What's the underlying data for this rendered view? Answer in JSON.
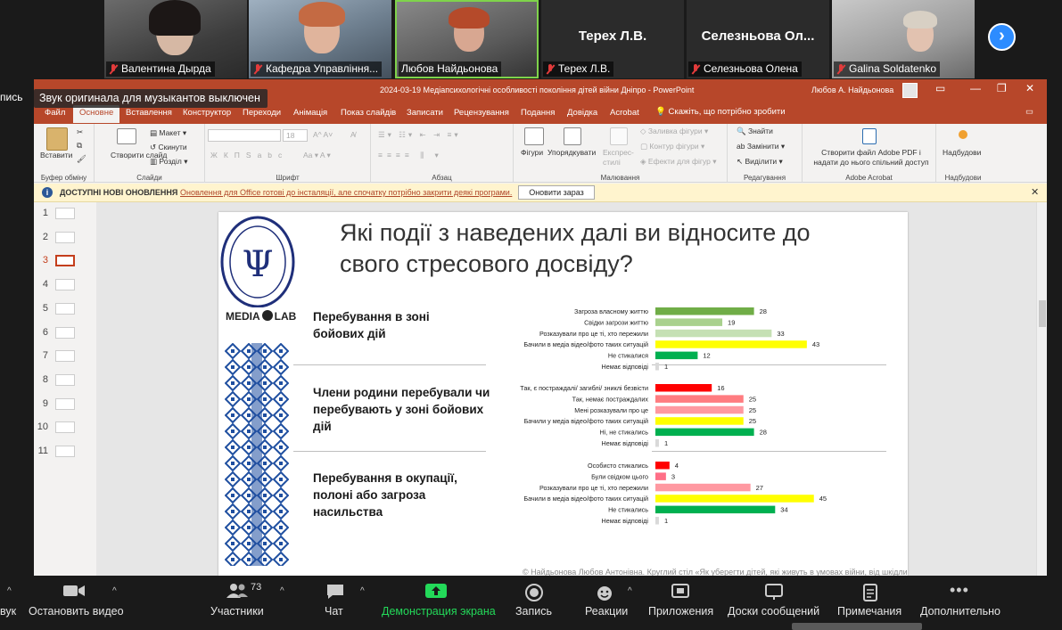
{
  "participants": [
    {
      "name": "Валентина Дырда",
      "type": "video"
    },
    {
      "name": "Кафедра Управління...",
      "type": "video"
    },
    {
      "name": "Любов Найдьонова",
      "type": "video"
    },
    {
      "name": "Терех Л.В.",
      "big_name": "Терех Л.В.",
      "type": "name"
    },
    {
      "name": "Селезньова Олена",
      "big_name": "Селезньова Ол...",
      "type": "name"
    },
    {
      "name": "Galina Soldatenko",
      "type": "video"
    }
  ],
  "zoom_notice": "Звук оригинала для музыкантов выключен",
  "zoom_left_fragment": "пись",
  "ppt": {
    "doc_title": "2024-03-19 Медіапсихологічні особливості покоління дітей війни Дніпро  -  PowerPoint",
    "user": "Любов А. Найдьонова",
    "tabs": [
      "Файл",
      "Основне",
      "Вставлення",
      "Конструктор",
      "Переходи",
      "Анімація",
      "Показ слайдів",
      "Записати",
      "Рецензування",
      "Подання",
      "Довідка",
      "Acrobat"
    ],
    "active_tab": "Основне",
    "tell_me": "Скажіть, що потрібно зробити",
    "ribbon": {
      "paste": "Вставити",
      "new_slide": "Створити слайд",
      "layout": "Макет",
      "reset": "Скинути",
      "section": "Розділ",
      "font_size": "18",
      "shapes": "Фігури",
      "arrange": "Упорядкувати",
      "quick_styles": "Експрес-стилі",
      "shape_fill": "Заливка фігури",
      "shape_outline": "Контур фігури",
      "shape_effects": "Ефекти для фігур",
      "find": "Знайти",
      "replace": "Замінити",
      "select": "Виділити",
      "acrobat_btn": "Створити файл Adobe PDF і надати до нього спільний доступ",
      "addins": "Надбудови",
      "groups": [
        "Буфер обміну",
        "Слайди",
        "Шрифт",
        "Абзац",
        "Малювання",
        "Редагування",
        "Adobe Acrobat",
        "Надбудови"
      ]
    },
    "update_bar": {
      "title": "ДОСТУПНІ НОВІ ОНОВЛЕННЯ",
      "message": "Оновлення для Office готові до інсталяції, але спочатку потрібно закрити деякі програми.",
      "button": "Оновити зараз"
    },
    "thumbnails": [
      "1",
      "2",
      "3",
      "4",
      "5",
      "6",
      "7",
      "8",
      "9",
      "10",
      "11"
    ],
    "selected_slide": "3"
  },
  "slide": {
    "title": "Які події з наведених далі ви відносите до свого стресового досвіду?",
    "logo_text": "MEDIA",
    "logo_text2": "LAB",
    "sections": [
      {
        "label": "Перебування в зоні бойових дій"
      },
      {
        "label": "Члени родини перебували чи перебувають у зоні бойових дій"
      },
      {
        "label": "Перебування в окупації, полоні або загроза насильства"
      }
    ],
    "footer": "© Найдьонова Любов Антонівна. Круглий стіл «Як уберегти дітей, які живуть в умовах війни, від шкідливої"
  },
  "chart_data": {
    "type": "bar",
    "orientation": "horizontal",
    "panels": [
      {
        "categories": [
          "Загроза власному життю",
          "Свідки загрози життю",
          "Розказували про це ті, хто пережили",
          "Бачили в медіа відео/фото таких ситуацій",
          "Не стикалися",
          "Немає відповіді"
        ],
        "values": [
          28,
          19,
          33,
          43,
          12,
          1
        ],
        "colors": [
          "#70ad47",
          "#a9d18e",
          "#c5e0b4",
          "#ffff00",
          "#00b050",
          "#d9d9d9"
        ]
      },
      {
        "categories": [
          "Так, є постраждалі/ загиблі/ зниклі безвісти",
          "Так, немає постраждалих",
          "Мені розказували про це",
          "Бачили у медіа відео/фото таких ситуацій",
          "Ні, не стикались",
          "Немає відповіді"
        ],
        "values": [
          16,
          25,
          25,
          25,
          28,
          1
        ],
        "colors": [
          "#ff0000",
          "#ff7c80",
          "#ff99a1",
          "#ffff00",
          "#00b050",
          "#d9d9d9"
        ]
      },
      {
        "categories": [
          "Особисто стикались",
          "Були свідком цього",
          "Розказували про це ті, хто пережили",
          "Бачили в медіа відео/фото таких ситуацій",
          "Не стикались",
          "Немає відповіді"
        ],
        "values": [
          4,
          3,
          27,
          45,
          34,
          1
        ],
        "colors": [
          "#ff0000",
          "#ff6f87",
          "#ff99a1",
          "#ffff00",
          "#00b050",
          "#d9d9d9"
        ]
      }
    ]
  },
  "toolbar": {
    "audio_fragment": "вук",
    "stop_video": "Остановить видео",
    "participants": "Участники",
    "participants_count": "73",
    "chat": "Чат",
    "share": "Демонстрация экрана",
    "record": "Запись",
    "reactions": "Реакции",
    "apps": "Приложения",
    "whiteboards": "Доски сообщений",
    "notes": "Примечания",
    "more": "Дополнительно"
  },
  "colors": {
    "ppt_accent": "#b7472a",
    "zoom_bg": "#1a1a1a",
    "share_green": "#23d959",
    "active_speaker": "#7fd34b"
  }
}
